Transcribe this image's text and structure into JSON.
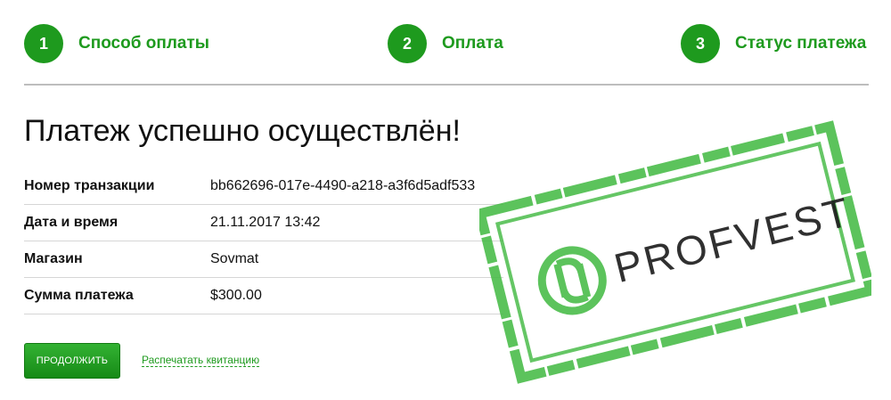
{
  "steps": [
    {
      "number": "1",
      "label": "Способ оплаты"
    },
    {
      "number": "2",
      "label": "Оплата"
    },
    {
      "number": "3",
      "label": "Статус платежа"
    }
  ],
  "title": "Платеж успешно осуществлён!",
  "details": [
    {
      "label": "Номер транзакции",
      "value": "bb662696-017e-4490-a218-a3f6d5adf533"
    },
    {
      "label": "Дата и время",
      "value": "21.11.2017 13:42"
    },
    {
      "label": "Магазин",
      "value": "Sovmat"
    },
    {
      "label": "Сумма платежа",
      "value": "$300.00"
    }
  ],
  "actions": {
    "continue_label": "ПРОДОЛЖИТЬ",
    "print_label": "Распечатать квитанцию"
  },
  "stamp": {
    "text": "PROFVEST",
    "icon": "profvest-logo-icon",
    "color": "#3fb83f"
  },
  "colors": {
    "accent": "#1e9a1e",
    "divider": "#bdbdbd",
    "row_border": "#d6d6d6"
  }
}
